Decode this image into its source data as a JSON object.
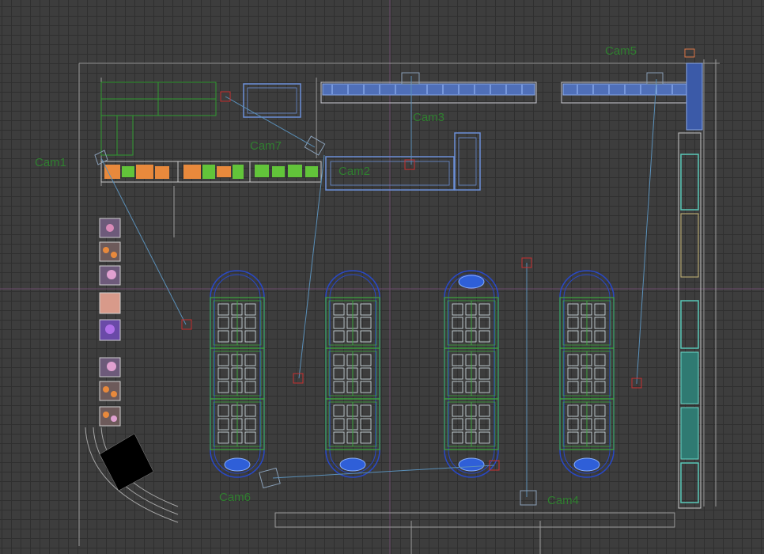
{
  "viewport": {
    "name": "top-view-layout",
    "colors": {
      "background": "#3d3d3d",
      "grid_minor": "#2f2f2f",
      "grid_major": "#262626",
      "axis_line": "#6b4a6b",
      "camera_label": "#2f7f2f",
      "camera_body": "#8aa0b8",
      "target_marker": "#c83030",
      "wall": "#9a9a9a",
      "shelf_blue": "#6b8fd8",
      "table_green": "#3ea83e",
      "table_white": "#d8e4ea",
      "table_end_blue": "#2848c8",
      "counter_orange": "#e8893c",
      "counter_green": "#62c43a"
    }
  },
  "cameras": [
    {
      "id": "cam1",
      "label": "Cam1"
    },
    {
      "id": "cam2",
      "label": "Cam2"
    },
    {
      "id": "cam3",
      "label": "Cam3"
    },
    {
      "id": "cam4",
      "label": "Cam4"
    },
    {
      "id": "cam5",
      "label": "Cam5"
    },
    {
      "id": "cam6",
      "label": "Cam6"
    },
    {
      "id": "cam7",
      "label": "Cam7"
    }
  ],
  "display_tables": [
    {
      "id": "table-1"
    },
    {
      "id": "table-2"
    },
    {
      "id": "table-3"
    },
    {
      "id": "table-4"
    }
  ]
}
